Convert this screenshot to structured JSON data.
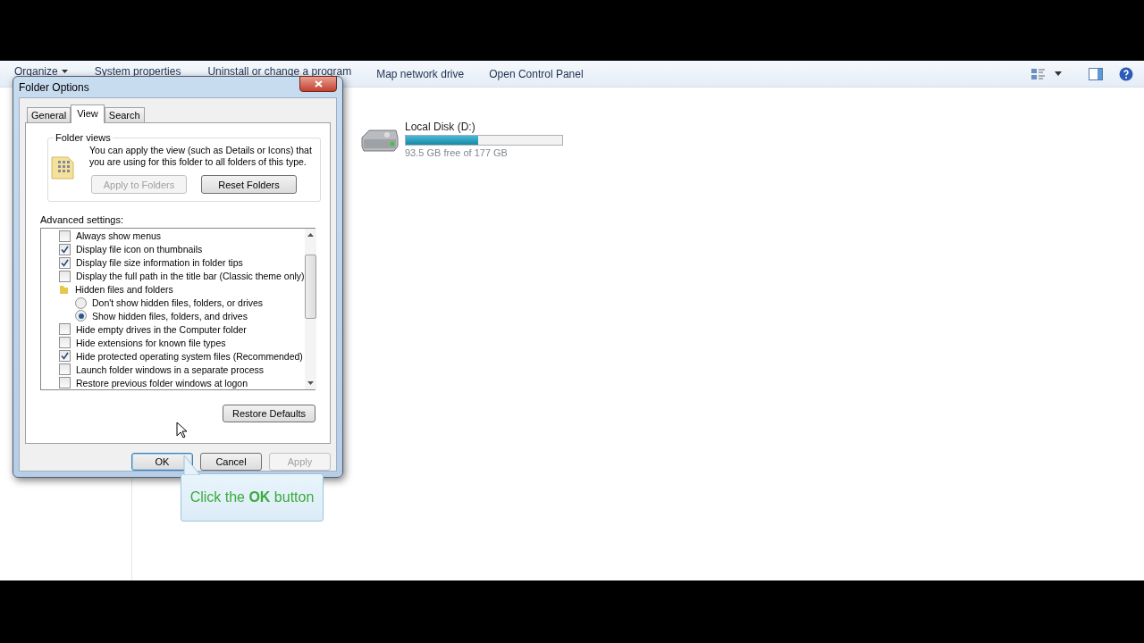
{
  "explorer": {
    "toolbar": [
      {
        "label": "Organize",
        "kind": "menu"
      },
      {
        "label": "System properties",
        "kind": "plain"
      },
      {
        "label": "Uninstall or change a program",
        "kind": "plain"
      },
      {
        "label": "Map network drive",
        "kind": "plain"
      },
      {
        "label": "Open Control Panel",
        "kind": "plain"
      }
    ],
    "drive": {
      "name": "Local Disk (D:)",
      "level": 0.46,
      "free": "93.5 GB free of 177 GB"
    }
  },
  "dialog": {
    "title": "Folder Options",
    "tabs": [
      {
        "label": "General",
        "selected": false
      },
      {
        "label": "View",
        "selected": true
      },
      {
        "label": "Search",
        "selected": false
      }
    ],
    "folder_views": {
      "heading": "Folder views",
      "text": "You can apply the view (such as Details or Icons) that you are using for this folder to all folders of this type.",
      "buttons": [
        {
          "label": "Apply to Folders",
          "disabled": true
        },
        {
          "label": "Reset Folders",
          "disabled": false
        }
      ]
    },
    "advanced_label": "Advanced settings:",
    "settings": [
      {
        "kind": "checkbox",
        "label": "Always show menus",
        "checked": false
      },
      {
        "kind": "checkbox",
        "label": "Display file icon on thumbnails",
        "checked": true
      },
      {
        "kind": "checkbox",
        "label": "Display file size information in folder tips",
        "checked": true
      },
      {
        "kind": "checkbox",
        "label": "Display the full path in the title bar (Classic theme only)",
        "checked": false
      },
      {
        "kind": "folder",
        "label": "Hidden files and folders"
      },
      {
        "kind": "radio",
        "label": "Don't show hidden files, folders, or drives",
        "selected": false
      },
      {
        "kind": "radio",
        "label": "Show hidden files, folders, and drives",
        "selected": true
      },
      {
        "kind": "checkbox",
        "label": "Hide empty drives in the Computer folder",
        "checked": false
      },
      {
        "kind": "checkbox",
        "label": "Hide extensions for known file types",
        "checked": false
      },
      {
        "kind": "checkbox",
        "label": "Hide protected operating system files (Recommended)",
        "checked": true
      },
      {
        "kind": "checkbox",
        "label": "Launch folder windows in a separate process",
        "checked": false
      },
      {
        "kind": "checkbox",
        "label": "Restore previous folder windows at logon",
        "checked": false
      }
    ],
    "restore_button": "Restore Defaults",
    "buttons": [
      {
        "label": "OK",
        "disabled": false,
        "default": true
      },
      {
        "label": "Cancel",
        "disabled": false,
        "default": false
      },
      {
        "label": "Apply",
        "disabled": true,
        "default": false
      }
    ]
  },
  "callout": "Click the **OK** button"
}
